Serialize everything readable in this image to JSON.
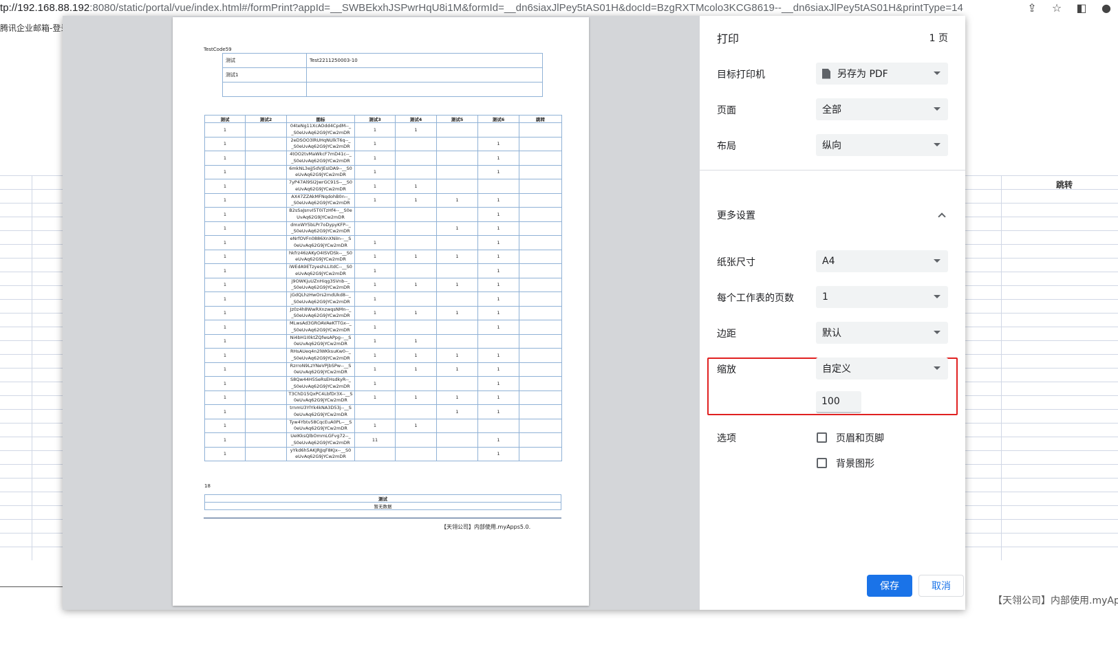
{
  "browser": {
    "url_host": "tp://192.168.88.192",
    "url_rest": ":8080/static/portal/vue/index.html#/formPrint?appId=__SWBEkxhJSPwrHqU8i1M&formId=__dn6siaxJlPey5tAS01H&docId=BzgRXTMcolo3KCG8619--__dn6siaxJlPey5tAS01H&printType=14",
    "bookmark": "腾讯企业邮箱-登录"
  },
  "background": {
    "column_label": "跳转",
    "footer": "【天翎公司】内部使用.myApps"
  },
  "print": {
    "title": "打印",
    "page_count": "1 页",
    "destination_label": "目标打印机",
    "destination_value": "另存为 PDF",
    "pages_label": "页面",
    "pages_value": "全部",
    "layout_label": "布局",
    "layout_value": "纵向",
    "more_settings_label": "更多设置",
    "paper_size_label": "纸张尺寸",
    "paper_size_value": "A4",
    "pages_per_sheet_label": "每个工作表的页数",
    "pages_per_sheet_value": "1",
    "margins_label": "边距",
    "margins_value": "默认",
    "scale_label": "缩放",
    "scale_value": "自定义",
    "scale_input": "100",
    "options_label": "选项",
    "option_headers": "页眉和页脚",
    "option_background": "背景图形",
    "save_label": "保存",
    "cancel_label": "取消"
  },
  "paper": {
    "code": "TestCode59",
    "top_table": [
      [
        "测试",
        "Test2211250003-10"
      ],
      [
        "测试1",
        ""
      ],
      [
        "",
        ""
      ]
    ],
    "headers": [
      "测试",
      "测试2",
      "图标",
      "测试3",
      "测试4",
      "测试5",
      "测试6",
      "跳转"
    ],
    "rows": [
      [
        "1",
        "",
        "04teNg11XcAOdd4CpdM--_",
        "_S0eUvAq62G9jYCw2mDR",
        "1",
        "1",
        "",
        "",
        ""
      ],
      [
        "1",
        "",
        "2eDSOO3lRUHqNUlkT6q--_",
        "_S0eUvAq62G9jYCw2mDR",
        "1",
        "",
        "",
        "1",
        ""
      ],
      [
        "1",
        "",
        "4tOO2tvMaWkcF7mD41c--_",
        "_S0eUvAq62G9jYCw2mDR",
        "1",
        "",
        "",
        "1",
        ""
      ],
      [
        "1",
        "",
        "6mkNL3ejJ5dVJEsIDA9--__S0",
        "eUvAq62G9jYCw2mDR",
        "1",
        "",
        "",
        "1",
        ""
      ],
      [
        "1",
        "",
        "7yP47Al9SI2JwrGC91S--__S0",
        "eUvAq62G9jYCw2mDR",
        "1",
        "1",
        "",
        "",
        ""
      ],
      [
        "1",
        "",
        "AX47ZZAkMFNqdohB0n--_",
        "_S0eUvAq62G9jYCw2mDR",
        "1",
        "1",
        "1",
        "1",
        ""
      ],
      [
        "1",
        "",
        "B2sSaJsnvI5T0iTzHf4--__S0e",
        "UvAq62G9jYCw2mDR",
        "",
        "",
        "",
        "1",
        ""
      ],
      [
        "1",
        "",
        "dmxWY5bLPr7oDypyKFP--_",
        "_S0eUvAq62G9jYCw2mDR",
        "",
        "",
        "1",
        "1",
        ""
      ],
      [
        "1",
        "",
        "eNrfOVFn0886XnXNiIn--__S",
        "0eUvAq62G9jYCw2mDR",
        "1",
        "",
        "",
        "1",
        ""
      ],
      [
        "1",
        "",
        "hkfrz46zAKyO4ISVDSk--__S0",
        "eUvAq62G9jYCw2mDR",
        "1",
        "1",
        "1",
        "1",
        ""
      ],
      [
        "1",
        "",
        "iWEdA9ETzyeshLLItdC--__S0",
        "eUvAq62G9jYCw2mDR",
        "1",
        "",
        "",
        "1",
        ""
      ],
      [
        "1",
        "",
        "j9OWKjuUZnHiqg3SVnb--_",
        "_S0eUvAq62G9jYCw2mDR",
        "1",
        "1",
        "1",
        "1",
        ""
      ],
      [
        "1",
        "",
        "jGdQLhzHwOrs2mdUkd8--_",
        "_S0eUvAq62G9jYCw2mDR",
        "1",
        "",
        "",
        "1",
        ""
      ],
      [
        "1",
        "",
        "Jz0z4h8WwRXnzwqsNMn--_",
        "_S0eUvAq62G9jYCw2mDR",
        "1",
        "1",
        "1",
        "1",
        ""
      ],
      [
        "1",
        "",
        "MLwsAd3GROAVAeKTTGx--_",
        "_S0eUvAq62G9jYCw2mDR",
        "1",
        "",
        "",
        "1",
        ""
      ],
      [
        "1",
        "",
        "Ni4bH1I0ktZQfwsAPpg--__S",
        "0eUvAq62G9jYCw2mDR",
        "1",
        "1",
        "",
        "",
        ""
      ],
      [
        "1",
        "",
        "RHsAUeq4n2lWKksuKw0--_",
        "_S0eUvAq62G9jYCw2mDR",
        "1",
        "1",
        "1",
        "1",
        ""
      ],
      [
        "1",
        "",
        "RzrroN9LzYNeVPjbSPw--__S",
        "0eUvAq62G9jYCw2mDR",
        "1",
        "1",
        "1",
        "1",
        ""
      ],
      [
        "1",
        "",
        "S8Qw44H5SeRsEHsdkyR--_",
        "_S0eUvAq62G9jYCw2mDR",
        "1",
        "",
        "",
        "1",
        ""
      ],
      [
        "1",
        "",
        "T3ChD15QxPC4LbfDr3X--__S",
        "0eUvAq62G9jYCw2mDR",
        "1",
        "1",
        "1",
        "1",
        ""
      ],
      [
        "1",
        "",
        "trnmU3YlYk4kNA3D53j--__S",
        "0eUvAq62G9jYCw2mDR",
        "",
        "",
        "1",
        "1",
        ""
      ],
      [
        "1",
        "",
        "Tyw4Ybtv58CqcEuA0PL--__S",
        "0eUvAq62G9jYCw2mDR",
        "1",
        "1",
        "",
        "",
        ""
      ],
      [
        "1",
        "",
        "UeIKksQlbOmmLGFvg72--_",
        "_S0eUvAq62G9jYCw2mDR",
        "11",
        "",
        "",
        "1",
        ""
      ],
      [
        "1",
        "",
        "yYkd6h5AKJRJJqF8KJx--__S0",
        "eUvAq62G9jYCw2mDR",
        "",
        "",
        "",
        "1",
        ""
      ]
    ],
    "count": "18",
    "sub_header": "测试",
    "sub_empty": "暂无数据",
    "footer": "【天翎公司】内部使用.myApps5.0."
  }
}
